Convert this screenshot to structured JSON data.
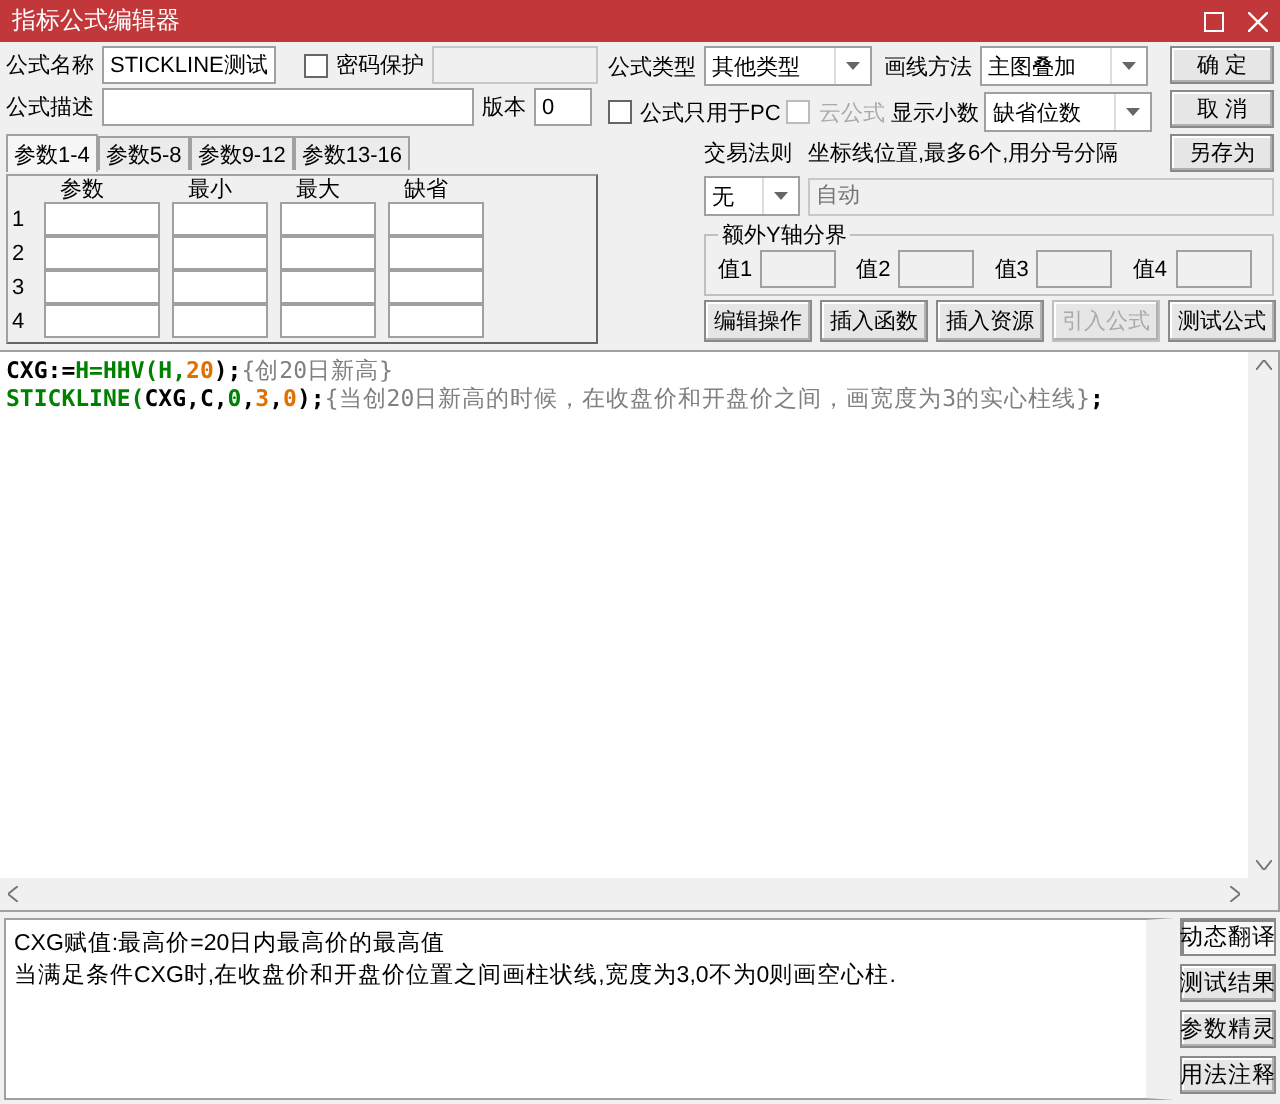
{
  "window": {
    "title": "指标公式编辑器"
  },
  "form": {
    "name": {
      "label": "公式名称",
      "value": "STICKLINE测试"
    },
    "password": {
      "label": "密码保护",
      "checked": false
    },
    "description": {
      "label": "公式描述"
    },
    "version": {
      "label": "版本",
      "value": "0"
    },
    "formula_type": {
      "label": "公式类型",
      "value": "其他类型"
    },
    "draw_method": {
      "label": "画线方法",
      "value": "主图叠加"
    },
    "pc_only": {
      "label": "公式只用于PC",
      "checked": false,
      "disabled": false
    },
    "cloud": {
      "label": "云公式",
      "checked": false,
      "disabled": true
    },
    "decimals": {
      "label": "显示小数",
      "value": "缺省位数"
    },
    "trade_rule": {
      "label": "交易法则",
      "value": "无"
    },
    "axis_lines": {
      "label": "坐标线位置,最多6个,用分号分隔",
      "placeholder": "自动"
    },
    "extra_y": {
      "title": "额外Y轴分界",
      "labels": [
        "值1",
        "值2",
        "值3",
        "值4"
      ]
    }
  },
  "side_buttons": [
    {
      "label": "确 定",
      "disabled": false
    },
    {
      "label": "取 消",
      "disabled": false
    },
    {
      "label": "另存为",
      "disabled": false
    }
  ],
  "param_tabs": [
    {
      "label": "参数1-4",
      "selected": true
    },
    {
      "label": "参数5-8",
      "selected": false
    },
    {
      "label": "参数9-12",
      "selected": false
    },
    {
      "label": "参数13-16",
      "selected": false
    }
  ],
  "param_columns": [
    "参数",
    "最小",
    "最大",
    "缺省"
  ],
  "param_rows": [
    "1",
    "2",
    "3",
    "4"
  ],
  "tool_buttons": [
    {
      "label": "编辑操作",
      "disabled": false
    },
    {
      "label": "插入函数",
      "disabled": false
    },
    {
      "label": "插入资源",
      "disabled": false
    },
    {
      "label": "引入公式",
      "disabled": true
    },
    {
      "label": "测试公式",
      "disabled": false
    }
  ],
  "code_lines": [
    [
      {
        "kind": "plain",
        "text": "CXG:="
      },
      {
        "kind": "function",
        "text": "H=HHV(H,"
      },
      {
        "kind": "number",
        "text": "20"
      },
      {
        "kind": "plain",
        "text": ");"
      },
      {
        "kind": "comment",
        "text": "{创20日新高}"
      }
    ],
    [
      {
        "kind": "function",
        "text": "STICKLINE("
      },
      {
        "kind": "plain",
        "text": "CXG,C,"
      },
      {
        "kind": "function",
        "text": "0"
      },
      {
        "kind": "plain",
        "text": ","
      },
      {
        "kind": "number",
        "text": "3"
      },
      {
        "kind": "plain",
        "text": ","
      },
      {
        "kind": "number",
        "text": "0"
      },
      {
        "kind": "plain",
        "text": ");"
      },
      {
        "kind": "comment",
        "text": "{当创20日新高的时候，在收盘价和开盘价之间，画宽度为3的实心柱线}"
      },
      {
        "kind": "plain",
        "text": ";"
      }
    ]
  ],
  "translation": {
    "lines": [
      "CXG赋值:最高价=20日内最高价的最高值",
      "当满足条件CXG时,在收盘价和开盘价位置之间画柱状线,宽度为3,0不为0则画空心柱."
    ],
    "buttons": [
      {
        "label": "动态翻译",
        "selected": true
      },
      {
        "label": "测试结果",
        "selected": false
      },
      {
        "label": "参数精灵",
        "selected": false
      },
      {
        "label": "用法注释",
        "selected": false
      }
    ]
  }
}
